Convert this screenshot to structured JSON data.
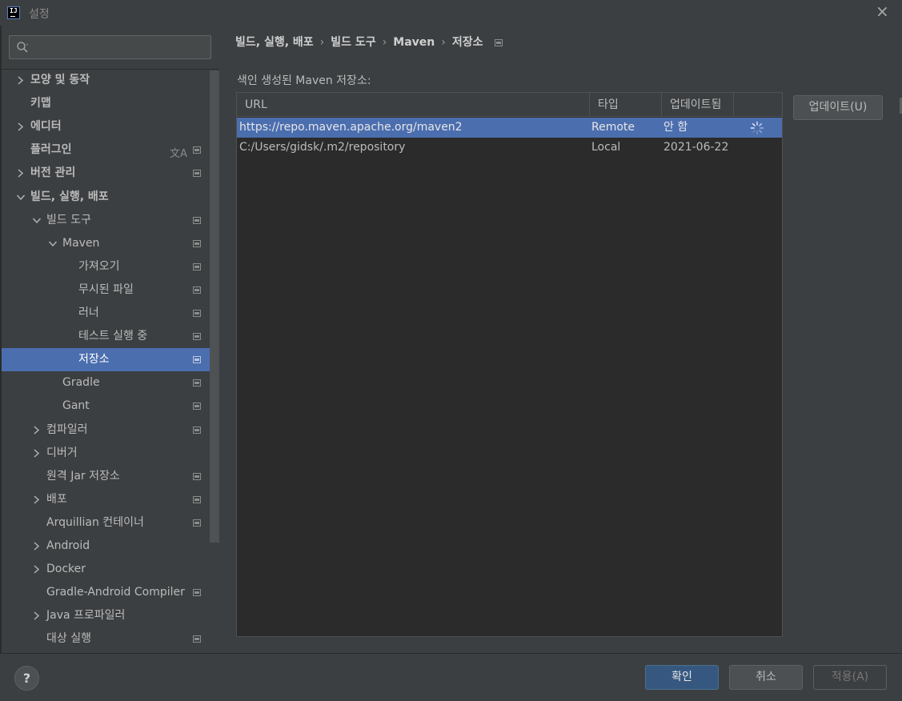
{
  "window": {
    "title": "설정"
  },
  "search": {
    "placeholder": ""
  },
  "sidebar": {
    "items": [
      {
        "label": "모양 및 동작",
        "bold": true,
        "chevron": "right",
        "indent": 0,
        "project_icon": false
      },
      {
        "label": "키맵",
        "bold": true,
        "chevron": "none",
        "indent": 0,
        "project_icon": false
      },
      {
        "label": "에디터",
        "bold": true,
        "chevron": "right",
        "indent": 0,
        "project_icon": false
      },
      {
        "label": "플러그인",
        "bold": true,
        "chevron": "none",
        "indent": 0,
        "project_icon": true,
        "translate_icon": true
      },
      {
        "label": "버전 관리",
        "bold": true,
        "chevron": "right",
        "indent": 0,
        "project_icon": true
      },
      {
        "label": "빌드, 실행, 배포",
        "bold": true,
        "chevron": "down",
        "indent": 0,
        "project_icon": false
      },
      {
        "label": "빌드 도구",
        "bold": false,
        "chevron": "down",
        "indent": 1,
        "project_icon": true
      },
      {
        "label": "Maven",
        "bold": false,
        "chevron": "down",
        "indent": 2,
        "project_icon": true
      },
      {
        "label": "가져오기",
        "bold": false,
        "chevron": "none",
        "indent": 3,
        "project_icon": true
      },
      {
        "label": "무시된 파일",
        "bold": false,
        "chevron": "none",
        "indent": 3,
        "project_icon": true
      },
      {
        "label": "러너",
        "bold": false,
        "chevron": "none",
        "indent": 3,
        "project_icon": true
      },
      {
        "label": "테스트 실행 중",
        "bold": false,
        "chevron": "none",
        "indent": 3,
        "project_icon": true
      },
      {
        "label": "저장소",
        "bold": false,
        "chevron": "none",
        "indent": 3,
        "project_icon": true,
        "selected": true
      },
      {
        "label": "Gradle",
        "bold": false,
        "chevron": "none",
        "indent": 2,
        "project_icon": true
      },
      {
        "label": "Gant",
        "bold": false,
        "chevron": "none",
        "indent": 2,
        "project_icon": true
      },
      {
        "label": "컴파일러",
        "bold": false,
        "chevron": "right",
        "indent": 1,
        "project_icon": true
      },
      {
        "label": "디버거",
        "bold": false,
        "chevron": "right",
        "indent": 1,
        "project_icon": false
      },
      {
        "label": "원격 Jar 저장소",
        "bold": false,
        "chevron": "none",
        "indent": 1,
        "project_icon": true
      },
      {
        "label": "배포",
        "bold": false,
        "chevron": "right",
        "indent": 1,
        "project_icon": true
      },
      {
        "label": "Arquillian 컨테이너",
        "bold": false,
        "chevron": "none",
        "indent": 1,
        "project_icon": true
      },
      {
        "label": "Android",
        "bold": false,
        "chevron": "right",
        "indent": 1,
        "project_icon": false
      },
      {
        "label": "Docker",
        "bold": false,
        "chevron": "right",
        "indent": 1,
        "project_icon": false
      },
      {
        "label": "Gradle-Android Compiler",
        "bold": false,
        "chevron": "none",
        "indent": 1,
        "project_icon": true
      },
      {
        "label": "Java 프로파일러",
        "bold": false,
        "chevron": "right",
        "indent": 1,
        "project_icon": false
      },
      {
        "label": "대상 실행",
        "bold": false,
        "chevron": "none",
        "indent": 1,
        "project_icon": true
      }
    ]
  },
  "breadcrumb": {
    "items": [
      "빌드, 실행, 배포",
      "빌드 도구",
      "Maven",
      "저장소"
    ],
    "separator": "›"
  },
  "repositories": {
    "section_label": "색인 생성된 Maven 저장소:",
    "columns": [
      "URL",
      "타입",
      "업데이트됨"
    ],
    "rows": [
      {
        "url": "https://repo.maven.apache.org/maven2",
        "type": "Remote",
        "updated": "안 함",
        "loading": true,
        "selected": true
      },
      {
        "url": "C:/Users/gidsk/.m2/repository",
        "type": "Local",
        "updated": "2021-06-22",
        "loading": false,
        "selected": false
      }
    ],
    "update_button": "업데이트(U)"
  },
  "footer": {
    "help_label": "?",
    "ok_label": "확인",
    "cancel_label": "취소",
    "apply_label": "적용(A)"
  },
  "colors": {
    "background": "#3c3f41",
    "selection": "#4b6eaf",
    "table_bg": "#2b2b2b",
    "primary_button": "#365880"
  }
}
